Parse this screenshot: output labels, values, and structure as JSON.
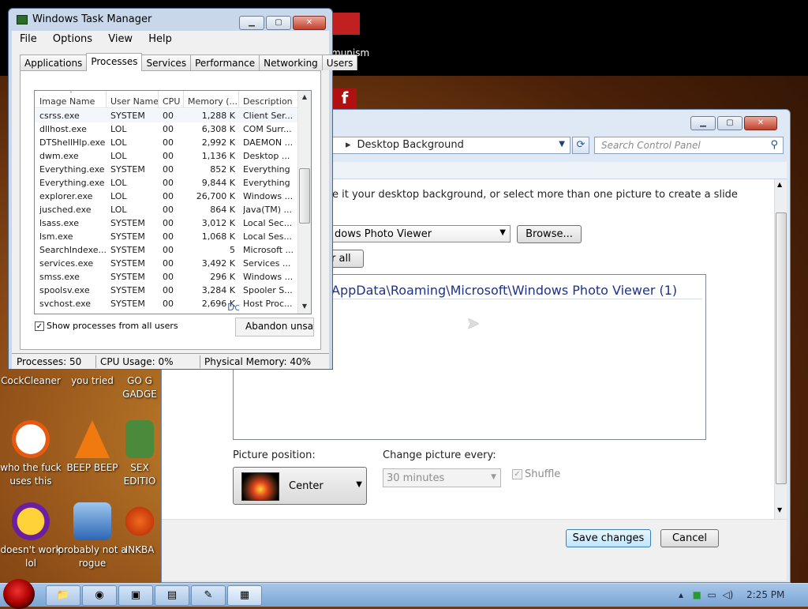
{
  "desktop": {
    "top_label": "munism",
    "icons": [
      {
        "label": "CockCleaner",
        "name": "cockcleaner"
      },
      {
        "label": "you tried",
        "name": "you-tried"
      },
      {
        "label": "GO G GADGE",
        "name": "go-gadge"
      },
      {
        "label": "who the fuck uses this",
        "name": "who-uses-this"
      },
      {
        "label": "BEEP BEEP",
        "name": "beep-beep"
      },
      {
        "label": "SEX EDITIO",
        "name": "sex-editio"
      },
      {
        "label": "doesn't work lol",
        "name": "doesnt-work"
      },
      {
        "label": "probably not a rogue",
        "name": "probably-not-rogue"
      },
      {
        "label": "INKBA",
        "name": "inkba"
      }
    ]
  },
  "control_panel": {
    "address": "Desktop Background",
    "search_placeholder": "Search Control Panel",
    "intro_text": "e it your desktop background, or select more than one picture to create a slide",
    "location_value": "dows Photo Viewer",
    "browse_label": "Browse...",
    "clear_all_label": "r all",
    "folder_header": "AppData\\Roaming\\Microsoft\\Windows Photo Viewer (1)",
    "picture_position_label": "Picture position:",
    "picture_position_value": "Center",
    "change_every_label": "Change picture every:",
    "change_every_value": "30 minutes",
    "shuffle_label": "Shuffle",
    "save_label": "Save changes",
    "cancel_label": "Cancel"
  },
  "task_manager": {
    "title": "Windows Task Manager",
    "menu": [
      "File",
      "Options",
      "View",
      "Help"
    ],
    "tabs": [
      "Applications",
      "Processes",
      "Services",
      "Performance",
      "Networking",
      "Users"
    ],
    "active_tab": "Processes",
    "columns": [
      "Image Name",
      "User Name",
      "CPU",
      "Memory (...",
      "Description"
    ],
    "processes": [
      {
        "image": "csrss.exe",
        "user": "SYSTEM",
        "cpu": "00",
        "mem": "1,288 K",
        "desc": "Client Ser..."
      },
      {
        "image": "dllhost.exe",
        "user": "LOL",
        "cpu": "00",
        "mem": "6,308 K",
        "desc": "COM Surr..."
      },
      {
        "image": "DTShellHlp.exe",
        "user": "LOL",
        "cpu": "00",
        "mem": "2,992 K",
        "desc": "DAEMON ..."
      },
      {
        "image": "dwm.exe",
        "user": "LOL",
        "cpu": "00",
        "mem": "1,136 K",
        "desc": "Desktop ..."
      },
      {
        "image": "Everything.exe",
        "user": "SYSTEM",
        "cpu": "00",
        "mem": "852 K",
        "desc": "Everything"
      },
      {
        "image": "Everything.exe",
        "user": "LOL",
        "cpu": "00",
        "mem": "9,844 K",
        "desc": "Everything"
      },
      {
        "image": "explorer.exe",
        "user": "LOL",
        "cpu": "00",
        "mem": "26,700 K",
        "desc": "Windows ..."
      },
      {
        "image": "jusched.exe",
        "user": "LOL",
        "cpu": "00",
        "mem": "864 K",
        "desc": "Java(TM) ..."
      },
      {
        "image": "lsass.exe",
        "user": "SYSTEM",
        "cpu": "00",
        "mem": "3,012 K",
        "desc": "Local Sec..."
      },
      {
        "image": "lsm.exe",
        "user": "SYSTEM",
        "cpu": "00",
        "mem": "1,068 K",
        "desc": "Local Ses..."
      },
      {
        "image": "SearchIndexe...",
        "user": "SYSTEM",
        "cpu": "00",
        "mem": "5",
        "desc": "Microsoft ..."
      },
      {
        "image": "services.exe",
        "user": "SYSTEM",
        "cpu": "00",
        "mem": "3,492 K",
        "desc": "Services ..."
      },
      {
        "image": "smss.exe",
        "user": "SYSTEM",
        "cpu": "00",
        "mem": "296 K",
        "desc": "Windows ..."
      },
      {
        "image": "spoolsv.exe",
        "user": "SYSTEM",
        "cpu": "00",
        "mem": "3,284 K",
        "desc": "Spooler S..."
      },
      {
        "image": "svchost.exe",
        "user": "SYSTEM",
        "cpu": "00",
        "mem": "2,696 K",
        "desc": "Host Proc..."
      }
    ],
    "ghost_text": "Dc",
    "show_all_label": "Show processes from all users",
    "end_process_label": "Abandon unsav",
    "status": {
      "processes": "Processes: 50",
      "cpu": "CPU Usage: 0%",
      "memory": "Physical Memory: 40%"
    }
  },
  "taskbar": {
    "clock": "2:25 PM",
    "tray_icons": [
      "show-hidden-icon",
      "battery-icon",
      "network-icon",
      "volume-icon"
    ]
  },
  "colors": {
    "accent": "#1e3287",
    "taskbar": "#8fb3dc",
    "window_frame": "#c9d7ea"
  }
}
